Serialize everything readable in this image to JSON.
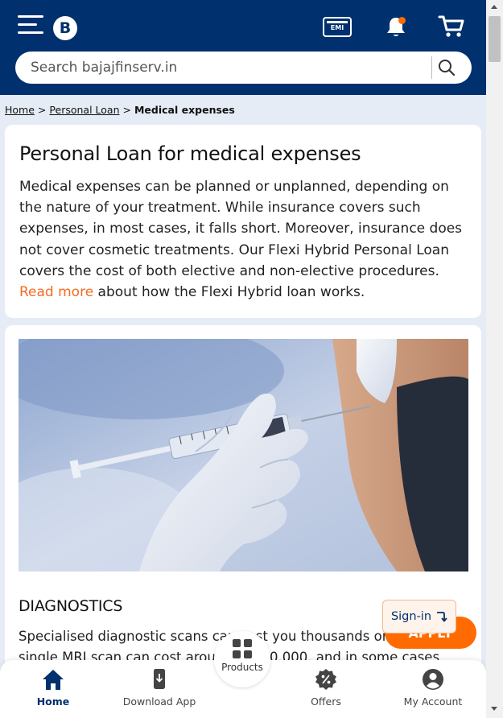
{
  "header": {
    "logo_letter": "B",
    "emi_label": "EMI",
    "search": {
      "placeholder": "Search bajajfinserv.in"
    },
    "colors": {
      "background": "#00306e",
      "notification_dot": "#ff6b00"
    }
  },
  "breadcrumb": {
    "items": [
      "Home",
      "Personal Loan"
    ],
    "separator": ">",
    "current": "Medical expenses"
  },
  "intro": {
    "title": "Personal Loan for medical expenses",
    "text_before_link": "Medical expenses can be planned or unplanned, depending on the nature of your treatment. While insurance covers such expenses, in most cases, it falls short. Moreover, insurance does not cover cosmetic treatments. Our Flexi Hybrid Personal Loan covers the cost of both elective and non-elective procedures. ",
    "link_text": "Read more",
    "text_after_link": " about how the Flexi Hybrid loan works.",
    "link_color": "#f36b21"
  },
  "section": {
    "image": "syringe-injection-photo",
    "heading": "DIAGNOSTICS",
    "text": "Specialised diagnostic scans can cost you thousands or lakhs. A single MRI scan can cost around Rs. 20,000, and in some cases"
  },
  "floating": {
    "apply_label": "APPLY",
    "signin_label": "Sign-in",
    "apply_color": "#ff6b00"
  },
  "bottom_nav": {
    "items": [
      {
        "label": "Home",
        "icon": "home-icon"
      },
      {
        "label": "Download App",
        "icon": "download-app-icon"
      },
      {
        "label": "Products",
        "icon": "products-grid-icon"
      },
      {
        "label": "Offers",
        "icon": "offers-percent-icon"
      },
      {
        "label": "My Account",
        "icon": "account-icon"
      }
    ],
    "active_color": "#00306e"
  }
}
